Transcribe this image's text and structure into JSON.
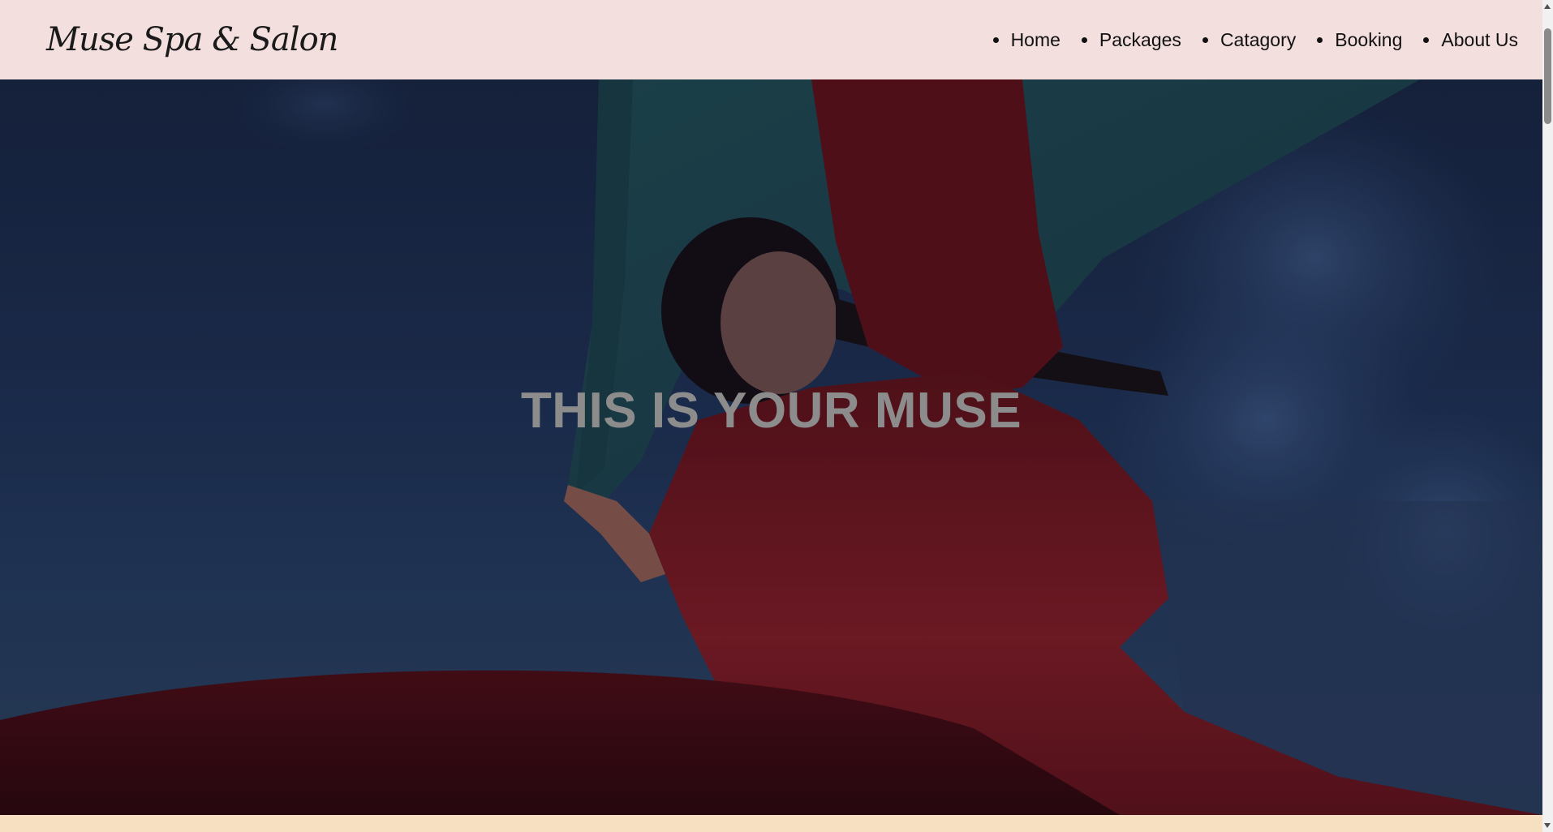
{
  "header": {
    "logo_text": "Muse Spa & Salon",
    "nav_items": [
      {
        "label": "Home"
      },
      {
        "label": "Packages"
      },
      {
        "label": "Catagory"
      },
      {
        "label": "Booking"
      },
      {
        "label": "About Us"
      }
    ]
  },
  "hero": {
    "title": "THIS IS YOUR MUSE",
    "image_icon": "hero-photo-woman-red-dress"
  },
  "colors": {
    "header_bg": "#f4dfdf",
    "hero_sky": "#1c2f52",
    "dress_red": "#7a1a22",
    "scarf_teal": "#1f4a52",
    "title_gray": "#8c8c8c",
    "bottom_band": "#f7dfc2"
  }
}
